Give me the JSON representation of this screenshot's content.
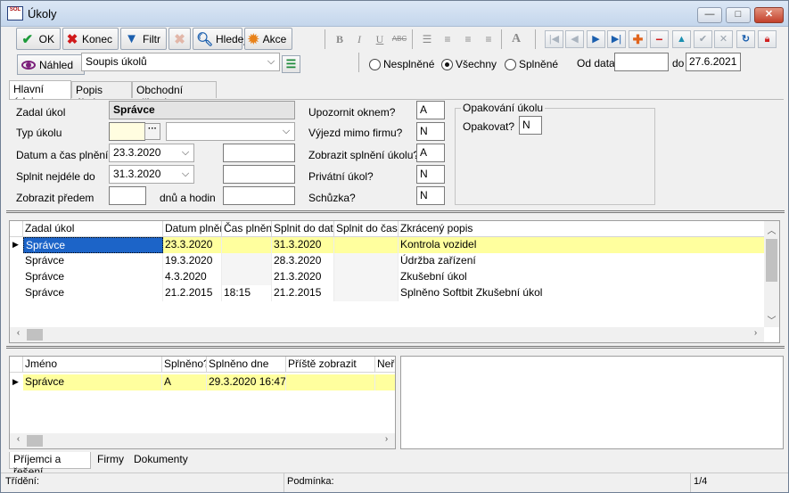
{
  "window": {
    "title": "Úkoly",
    "logo": "SOL"
  },
  "toolbar": {
    "ok_label": "OK",
    "konec_label": "Konec",
    "filtr_label": "Filtr",
    "hledej_label": "Hledej",
    "akce_label": "Akce"
  },
  "colors": {
    "accent_blue": "#1c64c8",
    "row_highlight": "#ffff9e",
    "close_red": "#c3402b"
  },
  "row2": {
    "nahled_label": "Náhled",
    "view_select": "Soupis úkolů",
    "radio_nesplnene": "Nesplněné",
    "radio_vsechny": "Všechny",
    "radio_splnene": "Splněné",
    "od_data_label": "Od data",
    "od_data_value": "",
    "do_label": "do",
    "do_value": "27.6.2021"
  },
  "tabs": [
    "Hlavní údaje",
    "Popis úkolu",
    "Obchodní případ"
  ],
  "form": {
    "zadal_label": "Zadal úkol",
    "zadal_value": "Správce",
    "typ_label": "Typ úkolu",
    "typ_value": "",
    "typ_select": "",
    "datum_label": "Datum a čas plnění",
    "datum_value": "23.3.2020",
    "datum_time": "",
    "splnit_label": "Splnit nejdéle do",
    "splnit_value": "31.3.2020",
    "splnit_time": "",
    "zobrazit_predem_label": "Zobrazit předem",
    "zobrazit_predem_value": "",
    "dnu_label": "dnů a hodin",
    "hodin_value": "",
    "upozornit_label": "Upozornit oknem?",
    "upozornit_value": "A",
    "vyjezd_label": "Výjezd mimo firmu?",
    "vyjezd_value": "N",
    "zobrazit_splneni_label": "Zobrazit splnění úkolu?",
    "zobrazit_splneni_value": "A",
    "privatni_label": "Privátní úkol?",
    "privatni_value": "N",
    "schuzka_label": "Schůzka?",
    "schuzka_value": "N",
    "opakovani_title": "Opakování úkolu",
    "opakovat_label": "Opakovat?",
    "opakovat_value": "N"
  },
  "tasks_grid": {
    "columns": [
      "Zadal úkol",
      "Datum plnění",
      "Čas plnění",
      "Splnit do data",
      "Splnit do času",
      "Zkrácený popis"
    ],
    "rows": [
      [
        "Správce",
        "23.3.2020",
        "",
        "31.3.2020",
        "",
        "Kontrola vozidel"
      ],
      [
        "Správce",
        "19.3.2020",
        "",
        "28.3.2020",
        "",
        "Údržba zařízení"
      ],
      [
        "Správce",
        "4.3.2020",
        "",
        "21.3.2020",
        "",
        "Zkušební úkol"
      ],
      [
        "Správce",
        "21.2.2015",
        "18:15",
        "21.2.2015",
        "",
        "Splněno Softbit Zkušební úkol"
      ]
    ]
  },
  "recipients_grid": {
    "columns": [
      "Jméno",
      "Splněno?",
      "Splněno dne",
      "Příště zobrazit",
      "Neř"
    ],
    "rows": [
      [
        "Správce",
        "A",
        "29.3.2020 16:47",
        "",
        ""
      ]
    ]
  },
  "bottom_tabs": [
    "Příjemci a řešení",
    "Firmy",
    "Dokumenty"
  ],
  "status": {
    "trideni_label": "Třídění:",
    "podminka_label": "Podmínka:",
    "position": "1/4"
  }
}
